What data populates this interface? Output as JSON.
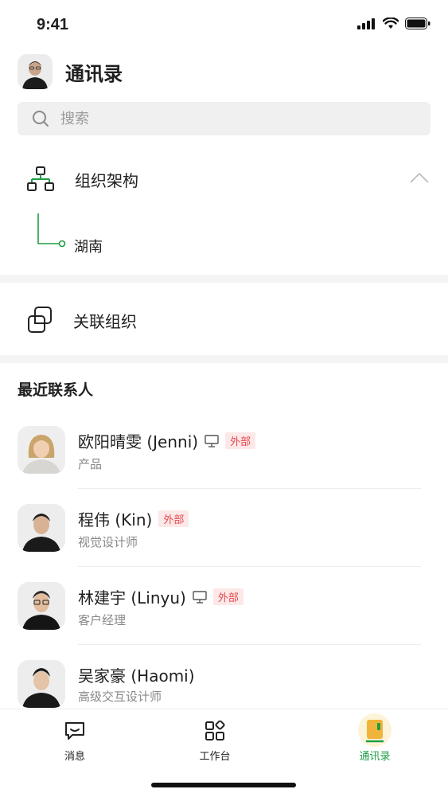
{
  "status_bar": {
    "time": "9:41"
  },
  "header": {
    "title": "通讯录"
  },
  "search": {
    "placeholder": "搜索"
  },
  "org": {
    "label": "组织架构",
    "children": [
      "湖南"
    ]
  },
  "related": {
    "label": "关联组织"
  },
  "recent": {
    "title": "最近联系人",
    "contacts": [
      {
        "name": "欧阳晴雯 (Jenni)",
        "role": "产品",
        "badge": "外部",
        "device_icon": true
      },
      {
        "name": "程伟 (Kin)",
        "role": "视觉设计师",
        "badge": "外部",
        "device_icon": false
      },
      {
        "name": "林建宇 (Linyu)",
        "role": "客户经理",
        "badge": "外部",
        "device_icon": true
      },
      {
        "name": "吴家豪 (Haomi)",
        "role": "高级交互设计师",
        "badge": "",
        "device_icon": false
      }
    ]
  },
  "tabbar": {
    "tabs": [
      {
        "label": "消息",
        "icon": "message-icon"
      },
      {
        "label": "工作台",
        "icon": "workbench-icon"
      },
      {
        "label": "通讯录",
        "icon": "contacts-icon",
        "active": true
      }
    ]
  },
  "colors": {
    "accent": "#1f9d45",
    "badge_bg": "#fde8e8",
    "badge_text": "#e5484d"
  }
}
